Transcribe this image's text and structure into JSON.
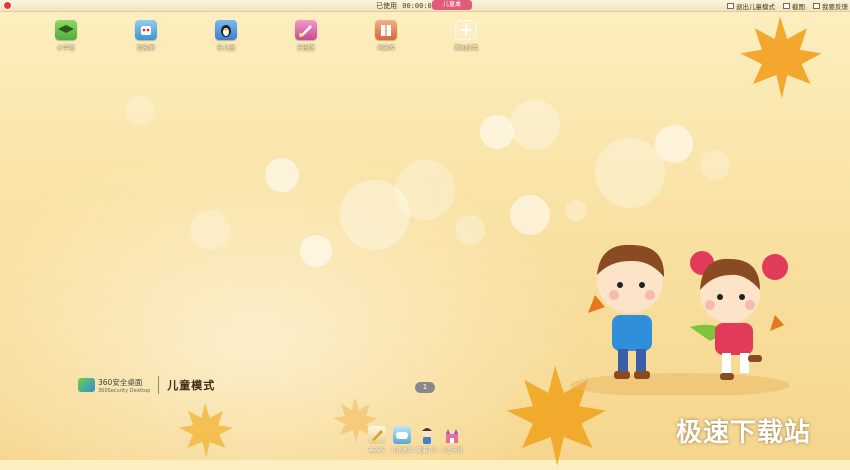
{
  "topbar": {
    "used_label": "已使用",
    "used_time": "00:00:08",
    "mode_badge": "儿童桌",
    "right_items": [
      {
        "label": "退出儿童模式",
        "icon": "exit-icon"
      },
      {
        "label": "截图",
        "icon": "screenshot-icon"
      },
      {
        "label": "我要反馈",
        "icon": "feedback-icon"
      }
    ]
  },
  "desktop_icons": [
    {
      "label": "小学堂",
      "icon": "graduation-cap-icon",
      "color": "#5fbf4a"
    },
    {
      "label": "智能屏",
      "icon": "robot-icon",
      "color": "#4fa6e0"
    },
    {
      "label": "乐儿园",
      "icon": "penguin-icon",
      "color": "#4a90d8"
    },
    {
      "label": "乐园区",
      "icon": "paint-icon",
      "color": "#e05aa0"
    },
    {
      "label": "词典库",
      "icon": "book-icon",
      "color": "#e07a4a"
    },
    {
      "label": "添加应用",
      "icon": "add-icon",
      "color": "#ffffff"
    }
  ],
  "brand": {
    "name": "360安全桌面",
    "sub": "360Security Desktop",
    "mode": "儿童模式"
  },
  "page_indicator": "1",
  "dock": [
    {
      "label": "画画板",
      "icon": "drawing-icon",
      "color": "#f0e0b0"
    },
    {
      "label": "儿童游戏",
      "icon": "game-icon",
      "color": "#8cc8e8"
    },
    {
      "label": "健康卫士",
      "icon": "boy-icon",
      "color": "#f6c9a0"
    },
    {
      "label": "儿童网址",
      "icon": "castle-icon",
      "color": "#e870a0"
    }
  ],
  "watermark": "极速下载站"
}
